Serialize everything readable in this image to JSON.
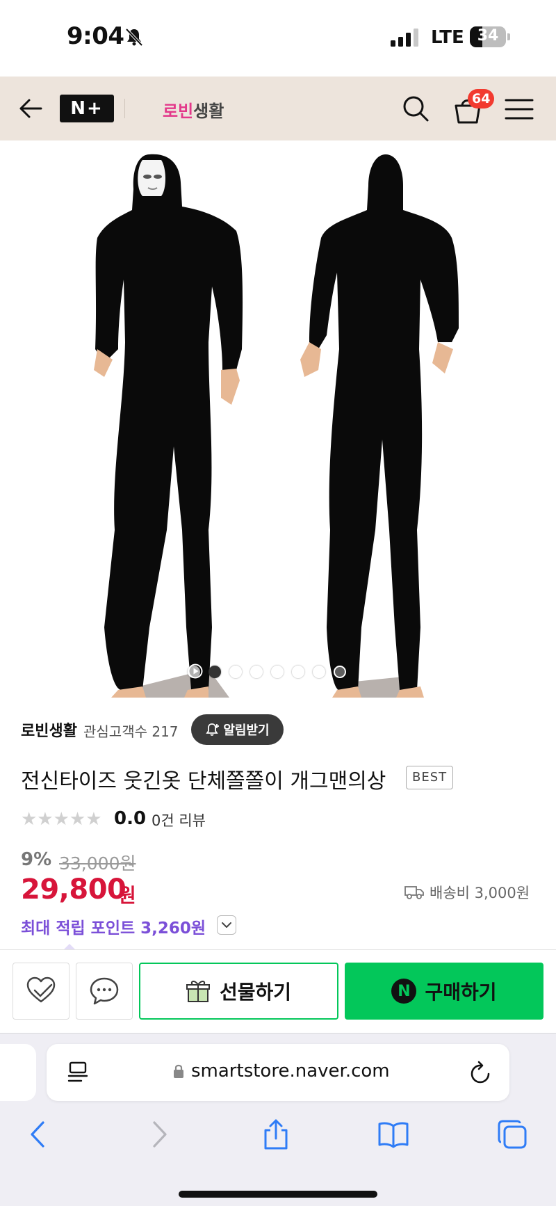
{
  "status_bar": {
    "time": "9:04",
    "network": "LTE",
    "battery_percent": "34",
    "battery_level": 0.34
  },
  "header": {
    "logo_text": "N+",
    "store_logo_prefix": "로빈",
    "store_logo_suffix": "생활",
    "cart_count": "64"
  },
  "product_image": {
    "total_slides": 8,
    "current_slide": 2,
    "shirt_color": "#000000",
    "mask_color": "#ffffff"
  },
  "seller": {
    "name": "로빈생활",
    "followers_label": "관심고객수 217",
    "notify_label": "알림받기"
  },
  "product": {
    "title": "전신타이즈 웃긴옷 단체쫄쫄이 개그맨의상",
    "badge": "BEST",
    "stars": "★★★★★",
    "rating": "0.0",
    "review_count": "0건 리뷰"
  },
  "price": {
    "discount_rate": "9%",
    "original_price": "33,000원",
    "sale_price": "29,800",
    "sale_unit": "원",
    "shipping": "배송비 3,000원",
    "points": "최대 적립 포인트 3,260원",
    "accent_color": "#d7153a",
    "points_color": "#7b4fd8"
  },
  "actions": {
    "gift_label": "선물하기",
    "buy_label": "구매하기",
    "buy_color": "#03c75a"
  },
  "browser": {
    "url": "smartstore.naver.com"
  }
}
